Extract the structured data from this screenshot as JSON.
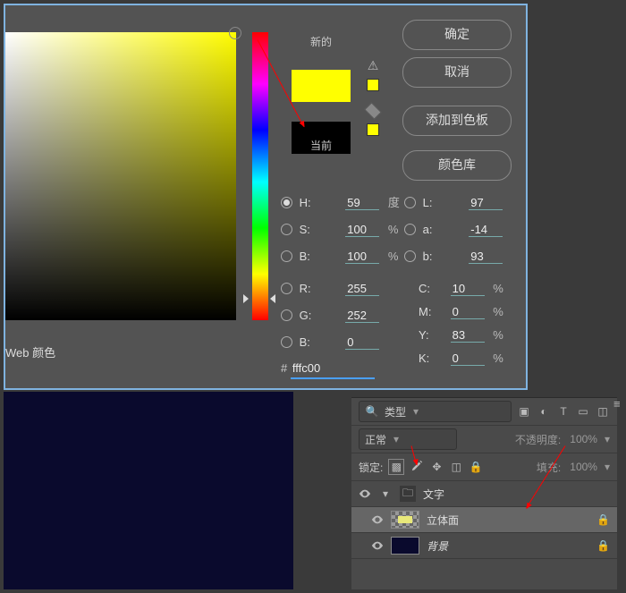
{
  "picker": {
    "newLabel": "新的",
    "currentLabel": "当前",
    "buttons": {
      "ok": "确定",
      "cancel": "取消",
      "addSwatch": "添加到色板",
      "colorLib": "颜色库"
    },
    "fields": {
      "H": {
        "label": "H:",
        "value": "59",
        "unit": "度"
      },
      "S": {
        "label": "S:",
        "value": "100",
        "unit": "%"
      },
      "Bv": {
        "label": "B:",
        "value": "100",
        "unit": "%"
      },
      "R": {
        "label": "R:",
        "value": "255"
      },
      "G": {
        "label": "G:",
        "value": "252"
      },
      "Bc": {
        "label": "B:",
        "value": "0"
      },
      "L": {
        "label": "L:",
        "value": "97"
      },
      "a": {
        "label": "a:",
        "value": "-14"
      },
      "b": {
        "label": "b:",
        "value": "93"
      },
      "C": {
        "label": "C:",
        "value": "10",
        "unit": "%"
      },
      "M": {
        "label": "M:",
        "value": "0",
        "unit": "%"
      },
      "Y": {
        "label": "Y:",
        "value": "83",
        "unit": "%"
      },
      "K": {
        "label": "K:",
        "value": "0",
        "unit": "%"
      }
    },
    "hex": {
      "label": "#",
      "value": "fffc00"
    },
    "webOnly": "Web 颜色",
    "colors": {
      "new": "#ffff00",
      "current": "#000000"
    }
  },
  "layers": {
    "kindLabel": "类型",
    "blendLabel": "正常",
    "opacityLabel": "不透明度:",
    "opacityValue": "100%",
    "lockLabel": "锁定:",
    "fillLabel": "填充:",
    "fillValue": "100%",
    "items": [
      {
        "name": "文字",
        "type": "folder",
        "indent": false,
        "thumb": "glyph",
        "locked": false,
        "selected": false
      },
      {
        "name": "立体面",
        "type": "layer",
        "indent": true,
        "thumb": "checker",
        "locked": true,
        "selected": true
      },
      {
        "name": "背景",
        "type": "bg",
        "indent": true,
        "thumb": "dark",
        "locked": true,
        "selected": false,
        "italic": true
      }
    ]
  },
  "filterIcons": [
    "image-icon",
    "adjust-icon",
    "text-icon",
    "shape-icon",
    "smart-icon"
  ],
  "searchIcon": "search-icon"
}
